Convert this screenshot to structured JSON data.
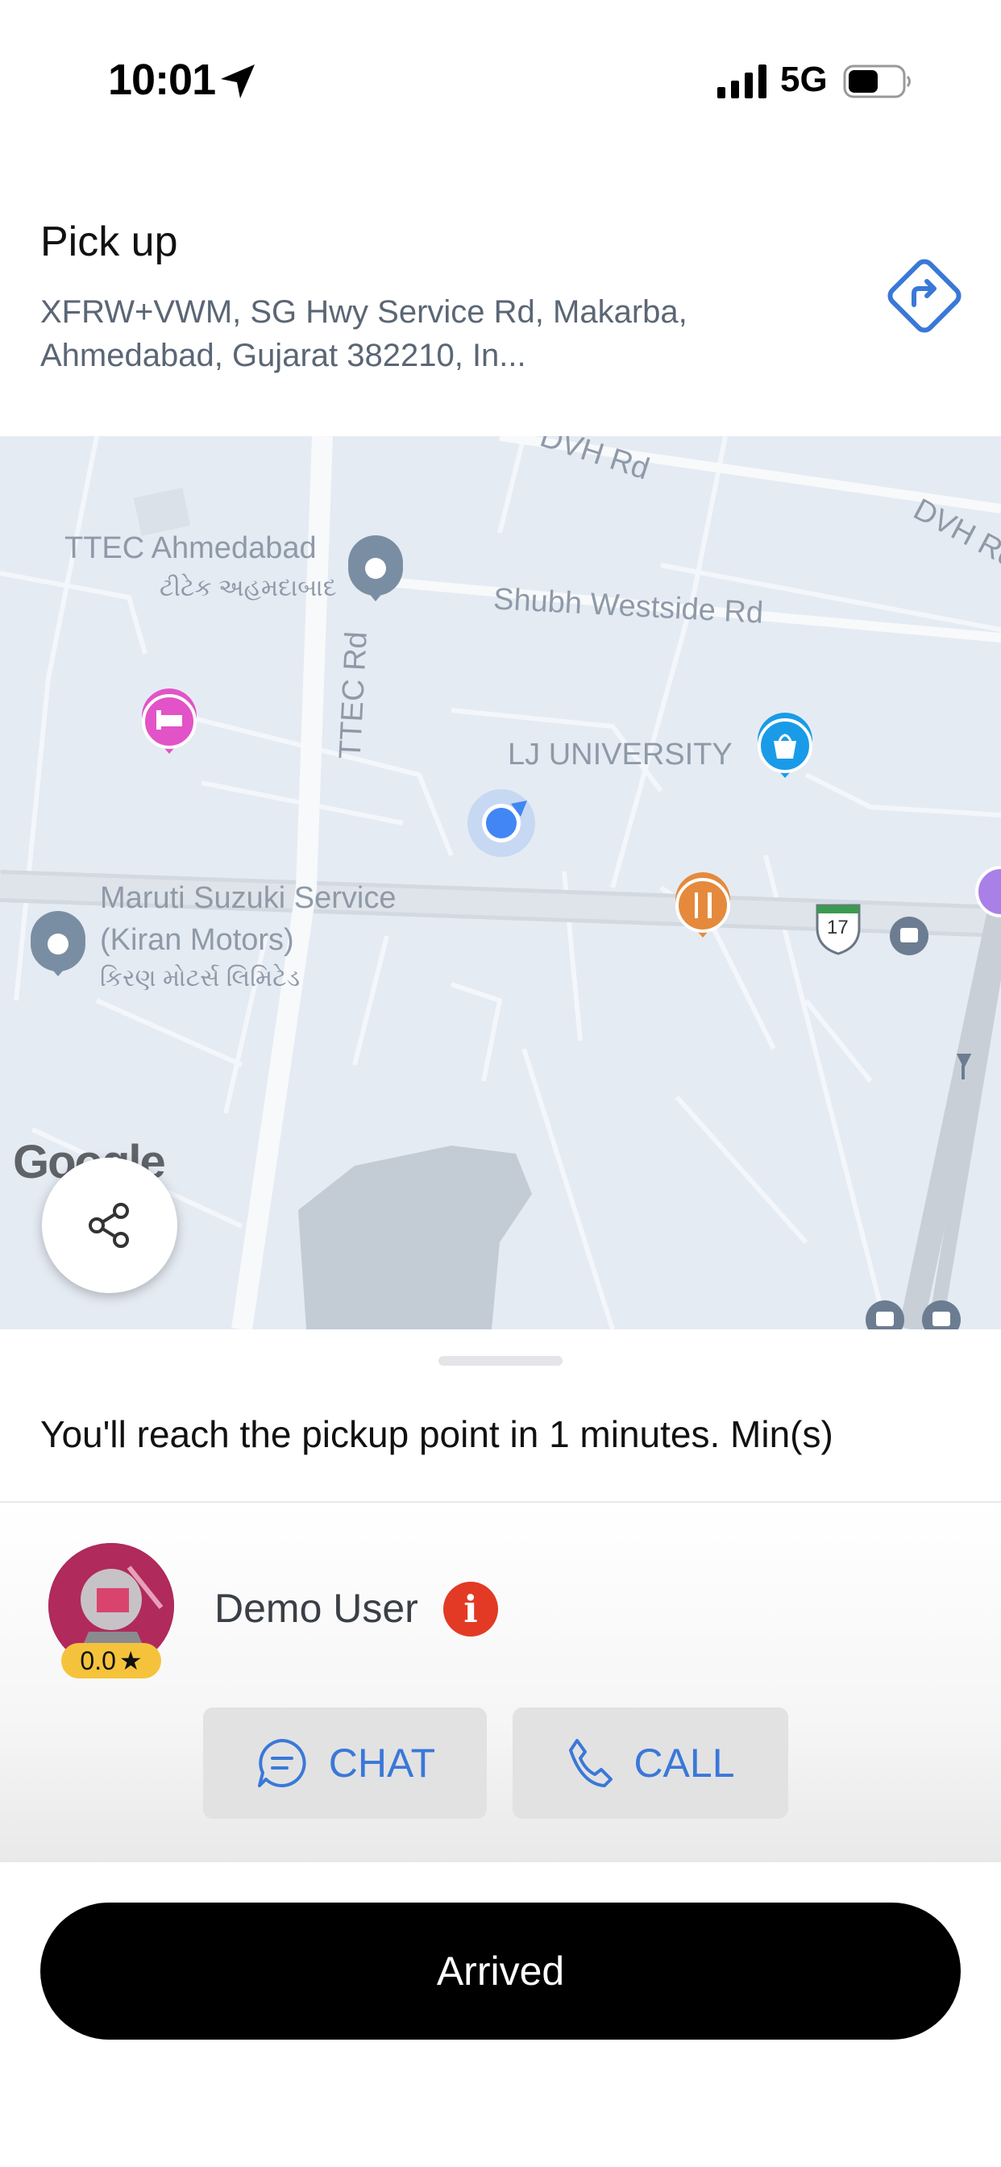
{
  "status_bar": {
    "time": "10:01",
    "network": "5G"
  },
  "pickup": {
    "title": "Pick up",
    "address": "XFRW+VWM, SG Hwy Service Rd, Makarba, Ahmedabad, Gujarat 382210, In...",
    "nav_icon": "directions-icon"
  },
  "map": {
    "labels": {
      "dvh_rd_top": "DVH Rd",
      "dvh_rd_right": "DVH Rd",
      "ttec_en": "TTEC Ahmedabad",
      "ttec_gu": "ટીટેક અહમદાબાદ",
      "shubh_westside": "Shubh Westside Rd",
      "ttec_rd": "TTEC Rd",
      "lj_university": "LJ UNIVERSITY",
      "maruti_1": "Maruti Suzuki Service",
      "maruti_2": "(Kiran Motors)",
      "maruti_gu": "કિરણ મોટર્સ લિમિટેડ",
      "highway_shield": "17"
    },
    "google_logo": "Google",
    "share_icon": "share-icon"
  },
  "trip": {
    "eta_text": "You'll reach the pickup point in 1 minutes. Min(s)"
  },
  "driver": {
    "name": "Demo User",
    "rating": "0.0",
    "rating_star": "★",
    "info": "i"
  },
  "actions": {
    "chat_label": "CHAT",
    "call_label": "CALL",
    "arrived_label": "Arrived"
  },
  "colors": {
    "accent": "#3a78d8",
    "info_red": "#e23a25",
    "rating_yellow": "#f5c33b",
    "map_bg": "#e5ebf3"
  }
}
